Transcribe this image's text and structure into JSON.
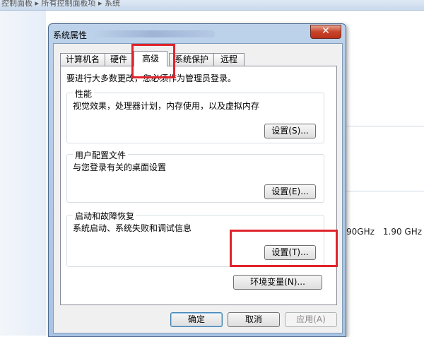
{
  "background": {
    "breadcrumb": "控制面板  ▸  所有控制面板项  ▸  系统",
    "cpu_speed_1": "90GHz",
    "cpu_speed_2": "1.90 GHz"
  },
  "dialog": {
    "title": "系统属性",
    "close_symbol": "✕",
    "tabs": [
      {
        "label": "计算机名",
        "active": false
      },
      {
        "label": "硬件",
        "active": false
      },
      {
        "label": "高级",
        "active": true
      },
      {
        "label": "系统保护",
        "active": false
      },
      {
        "label": "远程",
        "active": false
      }
    ],
    "intro": "要进行大多数更改，您必须作为管理员登录。",
    "performance": {
      "title": "性能",
      "description": "视觉效果，处理器计划，内存使用，以及虚拟内存",
      "button": "设置(S)..."
    },
    "user_profiles": {
      "title": "用户配置文件",
      "description": "与您登录有关的桌面设置",
      "button": "设置(E)..."
    },
    "startup_recovery": {
      "title": "启动和故障恢复",
      "description": "系统启动、系统失败和调试信息",
      "button": "设置(T)..."
    },
    "env_vars_button": "环境变量(N)...",
    "ok_button": "确定",
    "cancel_button": "取消",
    "apply_button": "应用(A)"
  },
  "colors": {
    "highlight": "#e0242c",
    "dialog_frame": "#a9c3e3",
    "close_button": "#c7452a"
  }
}
